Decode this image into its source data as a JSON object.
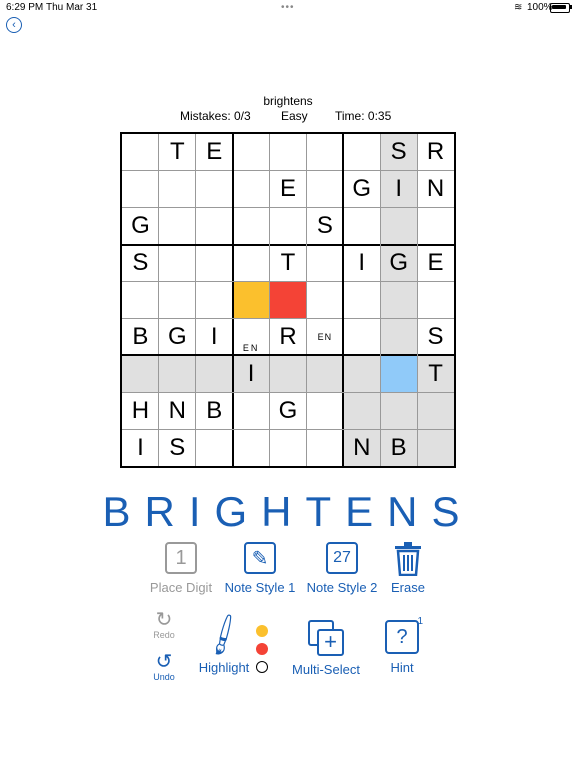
{
  "status": {
    "time": "6:29 PM",
    "date": "Thu Mar 31",
    "battery": "100%"
  },
  "header": {
    "word": "brightens",
    "mistakes": "Mistakes: 0/3",
    "difficulty": "Easy",
    "time": "Time:  0:35"
  },
  "grid": {
    "rows": [
      [
        "",
        "T",
        "E",
        "",
        "",
        "",
        "",
        "S",
        "R"
      ],
      [
        "",
        "",
        "",
        "",
        "E",
        "",
        "G",
        "I",
        "N"
      ],
      [
        "G",
        "",
        "",
        "",
        "",
        "S",
        "",
        "",
        ""
      ],
      [
        "S",
        "",
        "",
        "",
        "T",
        "",
        "I",
        "G",
        "E"
      ],
      [
        "",
        "",
        "",
        "",
        "",
        "",
        "",
        "",
        ""
      ],
      [
        "B",
        "G",
        "I",
        "",
        "R",
        "",
        "",
        "",
        "S"
      ],
      [
        "",
        "",
        "",
        "I",
        "",
        "",
        "",
        "",
        "T"
      ],
      [
        "H",
        "N",
        "B",
        "",
        "G",
        "",
        "",
        "",
        ""
      ],
      [
        "I",
        "S",
        "",
        "",
        "",
        "",
        "N",
        "B",
        ""
      ]
    ],
    "notes": [
      {
        "row": 5,
        "col": 3,
        "text": "EN"
      },
      {
        "row": 5,
        "col": 5,
        "text": "EN"
      }
    ],
    "highlight_color": "#e0e0e0",
    "yellow": "#fbc02d",
    "red": "#f44336",
    "selected": "#90caf9"
  },
  "brand_word": "BRIGHTENS",
  "toolbar": {
    "place_digit": {
      "icon": "1",
      "label": "Place Digit"
    },
    "note_style_1": {
      "label": "Note Style 1"
    },
    "note_style_2": {
      "icon": "27",
      "label": "Note Style 2"
    },
    "erase": {
      "label": "Erase"
    },
    "redo": {
      "label": "Redo"
    },
    "undo": {
      "label": "Undo"
    },
    "highlight": {
      "label": "Highlight"
    },
    "multi_select": {
      "label": "Multi-Select"
    },
    "hint": {
      "icon": "?",
      "count": "1",
      "label": "Hint"
    }
  },
  "accent": "#1a5fb4"
}
